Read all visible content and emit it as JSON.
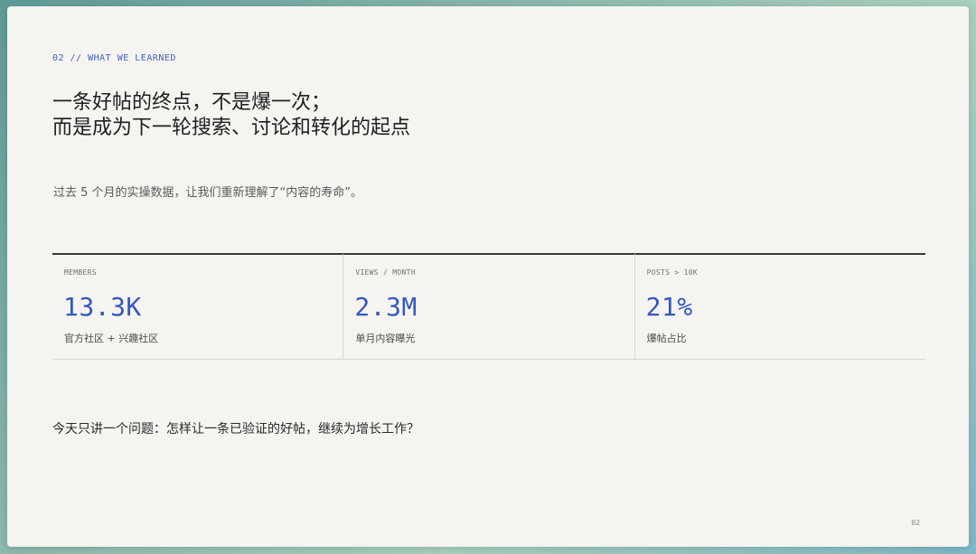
{
  "slide": {
    "section_tag": "02 // WHAT WE LEARNED",
    "headline": {
      "line1": "一条好帖的终点，不是爆一次；",
      "line2": "而是成为下一轮搜索、讨论和转化的起点"
    },
    "subtitle": "过去 5 个月的实操数据，让我们重新理解了“内容的寿命”。",
    "stats": [
      {
        "label": "MEMBERS",
        "value": "13.3K",
        "caption": "官方社区 + 兴趣社区"
      },
      {
        "label": "VIEWS / MONTH",
        "value": "2.3M",
        "caption": "单月内容曝光"
      },
      {
        "label": "POSTS > 10K",
        "value": "21%",
        "caption": "爆帖占比"
      }
    ],
    "question": "今天只讲一个问题：怎样让一条已验证的好帖，继续为增长工作？",
    "page_number": "02"
  },
  "colors": {
    "accent": "#3557c0",
    "slide_background": "#f5f4f0",
    "text": "#1e1e1e"
  }
}
